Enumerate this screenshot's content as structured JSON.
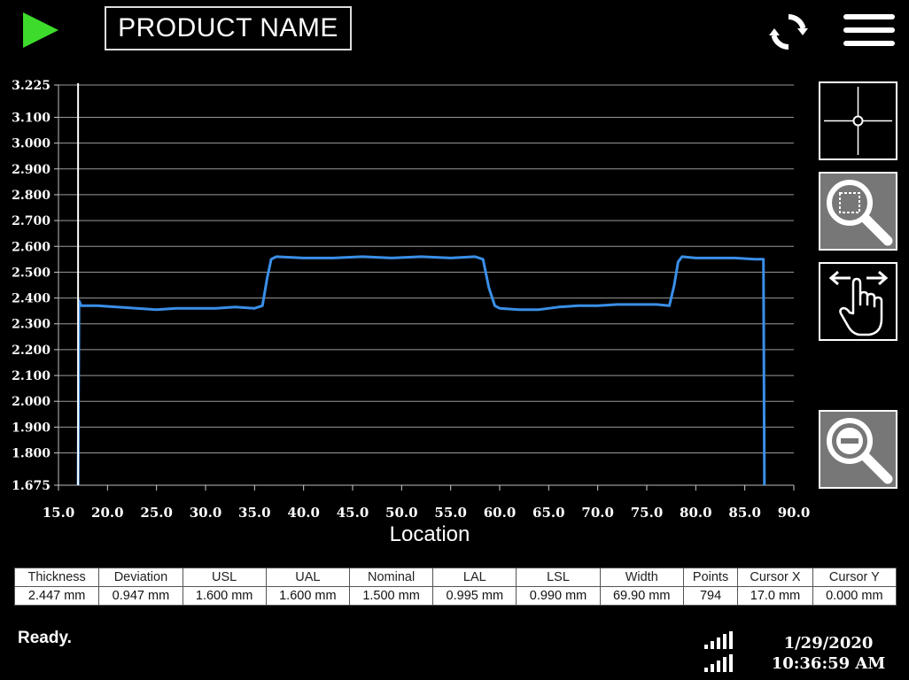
{
  "header": {
    "product_name": "PRODUCT NAME",
    "play_color": "#3ddc2c"
  },
  "chart_data": {
    "type": "line",
    "title": "",
    "xlabel": "Location",
    "ylabel": "",
    "xlim": [
      15.0,
      90.0
    ],
    "ylim": [
      1.675,
      3.225
    ],
    "x_ticks": [
      15.0,
      20.0,
      25.0,
      30.0,
      35.0,
      40.0,
      45.0,
      50.0,
      55.0,
      60.0,
      65.0,
      70.0,
      75.0,
      80.0,
      85.0,
      90.0
    ],
    "x_tick_labels": [
      "15.0",
      "20.0",
      "25.0",
      "30.0",
      "35.0",
      "40.0",
      "45.0",
      "50.0",
      "55.0",
      "60.0",
      "65.0",
      "70.0",
      "75.0",
      "80.0",
      "85.0",
      "90.0"
    ],
    "y_ticks": [
      1.675,
      1.8,
      1.9,
      2.0,
      2.1,
      2.2,
      2.3,
      2.4,
      2.5,
      2.6,
      2.7,
      2.8,
      2.9,
      3.0,
      3.1,
      3.225
    ],
    "y_tick_labels": [
      "1.675",
      "1.800",
      "1.900",
      "2.000",
      "2.100",
      "2.200",
      "2.300",
      "2.400",
      "2.500",
      "2.600",
      "2.700",
      "2.800",
      "2.900",
      "3.000",
      "3.100",
      "3.225"
    ],
    "grid": true,
    "line_color": "#3a8fe8",
    "cursor_x": 17.0,
    "series": [
      {
        "x": [
          17.0,
          17.1,
          17.3,
          19.0,
          21.0,
          23.0,
          25.0,
          27.0,
          29.0,
          31.0,
          33.0,
          35.0,
          35.8,
          36.3,
          36.7,
          37.2,
          40.0,
          43.0,
          46.0,
          49.0,
          52.0,
          55.0,
          57.5,
          58.3,
          58.9,
          59.5,
          60.0,
          62.0,
          64.0,
          66.0,
          68.0,
          70.0,
          72.0,
          74.0,
          76.0,
          77.3,
          77.8,
          78.2,
          78.6,
          80.0,
          82.0,
          84.0,
          86.0,
          86.9,
          87.0
        ],
        "y": [
          1.675,
          2.39,
          2.37,
          2.37,
          2.365,
          2.36,
          2.355,
          2.36,
          2.36,
          2.36,
          2.365,
          2.36,
          2.37,
          2.48,
          2.55,
          2.56,
          2.555,
          2.555,
          2.56,
          2.555,
          2.56,
          2.555,
          2.56,
          2.55,
          2.44,
          2.37,
          2.36,
          2.355,
          2.355,
          2.365,
          2.37,
          2.37,
          2.375,
          2.375,
          2.375,
          2.37,
          2.45,
          2.54,
          2.56,
          2.555,
          2.555,
          2.555,
          2.55,
          2.55,
          1.675
        ]
      }
    ]
  },
  "tools": {
    "crosshair": "crosshair-icon",
    "zoom_box": "zoom-box-icon",
    "pan": "pan-hand-icon",
    "zoom_out": "zoom-out-icon"
  },
  "stats": {
    "headers": [
      "Thickness",
      "Deviation",
      "USL",
      "UAL",
      "Nominal",
      "LAL",
      "LSL",
      "Width",
      "Points",
      "Cursor X",
      "Cursor Y"
    ],
    "values": [
      "2.447 mm",
      "0.947 mm",
      "1.600 mm",
      "1.600 mm",
      "1.500 mm",
      "0.995 mm",
      "0.990 mm",
      "69.90 mm",
      "794",
      "17.0 mm",
      "0.000 mm"
    ]
  },
  "status": {
    "text": "Ready.",
    "date": "1/29/2020",
    "time": "10:36:59 AM"
  }
}
